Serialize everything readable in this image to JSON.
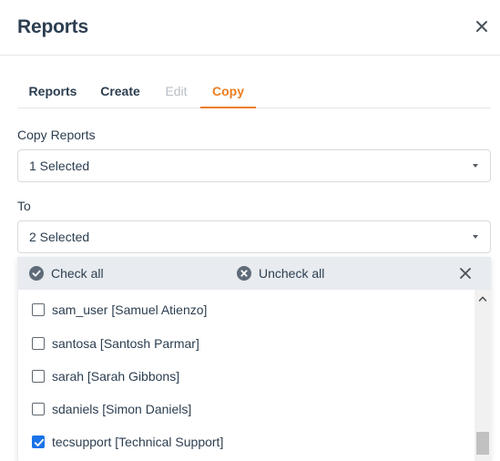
{
  "header": {
    "title": "Reports"
  },
  "tabs": [
    {
      "label": "Reports",
      "state": "default"
    },
    {
      "label": "Create",
      "state": "default"
    },
    {
      "label": "Edit",
      "state": "disabled"
    },
    {
      "label": "Copy",
      "state": "active"
    }
  ],
  "copy_reports": {
    "label": "Copy Reports",
    "value": "1 Selected"
  },
  "to": {
    "label": "To",
    "value": "2 Selected"
  },
  "dropdown": {
    "check_all": "Check all",
    "uncheck_all": "Uncheck all",
    "options": [
      {
        "label": "sam_user [Samuel Atienzo]",
        "checked": false
      },
      {
        "label": "santosa [Santosh Parmar]",
        "checked": false
      },
      {
        "label": "sarah [Sarah Gibbons]",
        "checked": false
      },
      {
        "label": "sdaniels [Simon Daniels]",
        "checked": false
      },
      {
        "label": "tecsupport [Technical Support]",
        "checked": true
      }
    ]
  },
  "colors": {
    "accent": "#ee7d1f",
    "checkbox_checked": "#1a73e8",
    "text": "#2c3e50",
    "disabled_text": "#b8bec5"
  },
  "icons": {
    "close": "close-icon",
    "check_all": "check-circle-icon",
    "uncheck_all": "x-circle-icon",
    "caret": "caret-down-icon",
    "scroll_up": "chevron-up-icon"
  }
}
